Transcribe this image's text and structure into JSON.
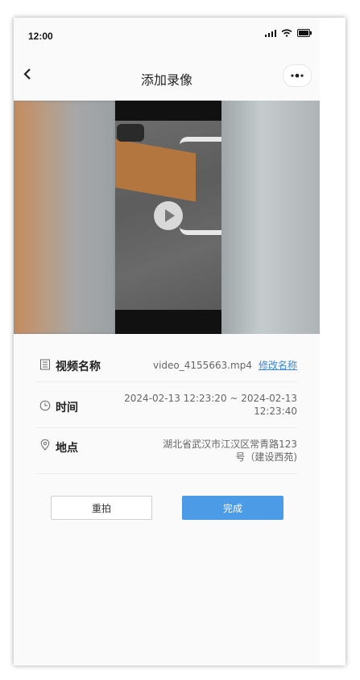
{
  "status_bar": {
    "time": "12:00"
  },
  "navbar": {
    "title": "添加录像",
    "back_icon": "chevron-left-icon",
    "more_icon": "more-dots-icon"
  },
  "video": {
    "play_icon": "play-icon"
  },
  "info": {
    "name": {
      "label": "视频名称",
      "value": "video_4155663.mp4",
      "edit_label": "修改名称",
      "icon": "document-icon"
    },
    "time": {
      "label": "时间",
      "value_line1": "2024-02-13 12:23:20 ~ 2024-02-13",
      "value_line2": "12:23:40",
      "icon": "clock-icon"
    },
    "location": {
      "label": "地点",
      "value_line1": "湖北省武汉市江汉区常青路123",
      "value_line2": "号（建设西苑)",
      "icon": "location-pin-icon"
    }
  },
  "actions": {
    "retake_label": "重拍",
    "done_label": "完成"
  },
  "colors": {
    "accent": "#4b9be6",
    "link": "#3a86d8"
  }
}
